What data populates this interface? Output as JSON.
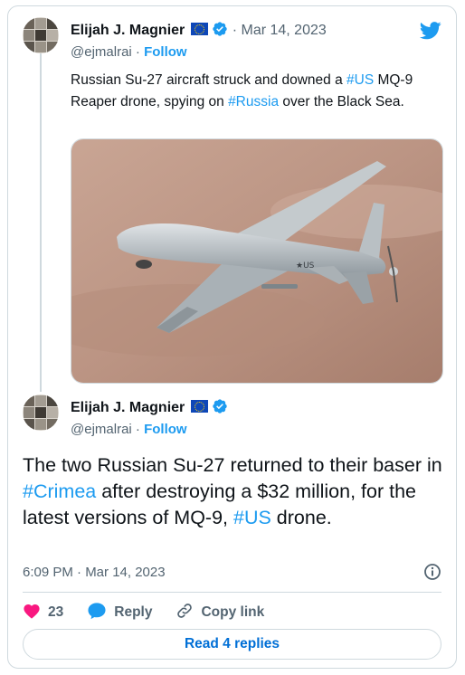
{
  "tweet1": {
    "author_name": "Elijah J. Magnier",
    "date": "· Mar 14, 2023",
    "handle": "@ejmalrai",
    "dot": "·",
    "follow_label": "Follow",
    "text_parts": [
      "Russian Su-27 aircraft struck and downed a ",
      "#US",
      " MQ-9 Reaper drone, spying on ",
      "#Russia",
      " over the Black Sea."
    ],
    "image_icon": "mq9-reaper-drone-photo"
  },
  "tweet2": {
    "author_name": "Elijah J. Magnier",
    "handle": "@ejmalrai",
    "dot": "·",
    "follow_label": "Follow",
    "text_parts": [
      "The two Russian Su-27 returned to their baser in ",
      "#Crimea",
      " after destroying a $32 million, for the latest versions of MQ-9, ",
      "#US",
      " drone."
    ],
    "timestamp": "6:09 PM · Mar 14, 2023"
  },
  "actions": {
    "like_count": "23",
    "reply_label": "Reply",
    "copy_link_label": "Copy link"
  },
  "read_replies_label": "Read 4 replies",
  "colors": {
    "accent": "#1d9bf0",
    "like": "#f91880",
    "eu_flag": "#0e47b8",
    "read_button_text": "#006fd6"
  },
  "icons": [
    "twitter-bird-icon",
    "eu-flag-icon",
    "verified-badge-icon",
    "info-icon",
    "heart-icon",
    "reply-bubble-icon",
    "link-icon"
  ]
}
